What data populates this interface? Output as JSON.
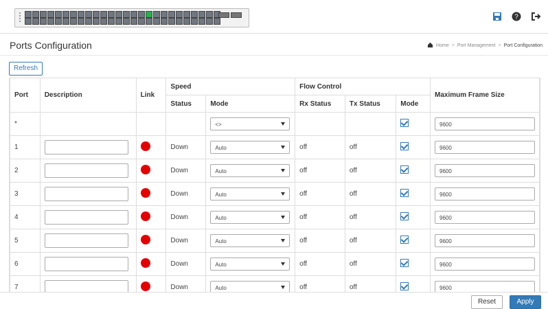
{
  "header": {
    "icons": [
      "save-icon",
      "help-icon",
      "logout-icon"
    ],
    "colors": {
      "accent": "#337ab7"
    }
  },
  "page": {
    "title": "Ports Configuration",
    "breadcrumb": [
      "Home",
      "Port Management",
      "Port Configuration"
    ]
  },
  "toolbar": {
    "refresh_label": "Refresh"
  },
  "table": {
    "group_headers": {
      "speed": "Speed",
      "flow_control": "Flow Control"
    },
    "columns": {
      "port": "Port",
      "description": "Description",
      "link": "Link",
      "status": "Status",
      "mode": "Mode",
      "rx_status": "Rx Status",
      "tx_status": "Tx Status",
      "fc_mode": "Mode",
      "max_frame": "Maximum Frame Size"
    },
    "all_row": {
      "port": "*",
      "mode": "<>",
      "fc_checked": true,
      "max_frame": "9600"
    },
    "rows": [
      {
        "port": "1",
        "status": "Down",
        "mode": "Auto",
        "rx": "off",
        "tx": "off",
        "fc_checked": true,
        "max_frame": "9600"
      },
      {
        "port": "2",
        "status": "Down",
        "mode": "Auto",
        "rx": "off",
        "tx": "off",
        "fc_checked": true,
        "max_frame": "9600"
      },
      {
        "port": "3",
        "status": "Down",
        "mode": "Auto",
        "rx": "off",
        "tx": "off",
        "fc_checked": true,
        "max_frame": "9600"
      },
      {
        "port": "4",
        "status": "Down",
        "mode": "Auto",
        "rx": "off",
        "tx": "off",
        "fc_checked": true,
        "max_frame": "9600"
      },
      {
        "port": "5",
        "status": "Down",
        "mode": "Auto",
        "rx": "off",
        "tx": "off",
        "fc_checked": true,
        "max_frame": "9600"
      },
      {
        "port": "6",
        "status": "Down",
        "mode": "Auto",
        "rx": "off",
        "tx": "off",
        "fc_checked": true,
        "max_frame": "9600"
      },
      {
        "port": "7",
        "status": "Down",
        "mode": "Auto",
        "rx": "off",
        "tx": "off",
        "fc_checked": true,
        "max_frame": "9600"
      }
    ]
  },
  "footer": {
    "reset_label": "Reset",
    "apply_label": "Apply"
  }
}
